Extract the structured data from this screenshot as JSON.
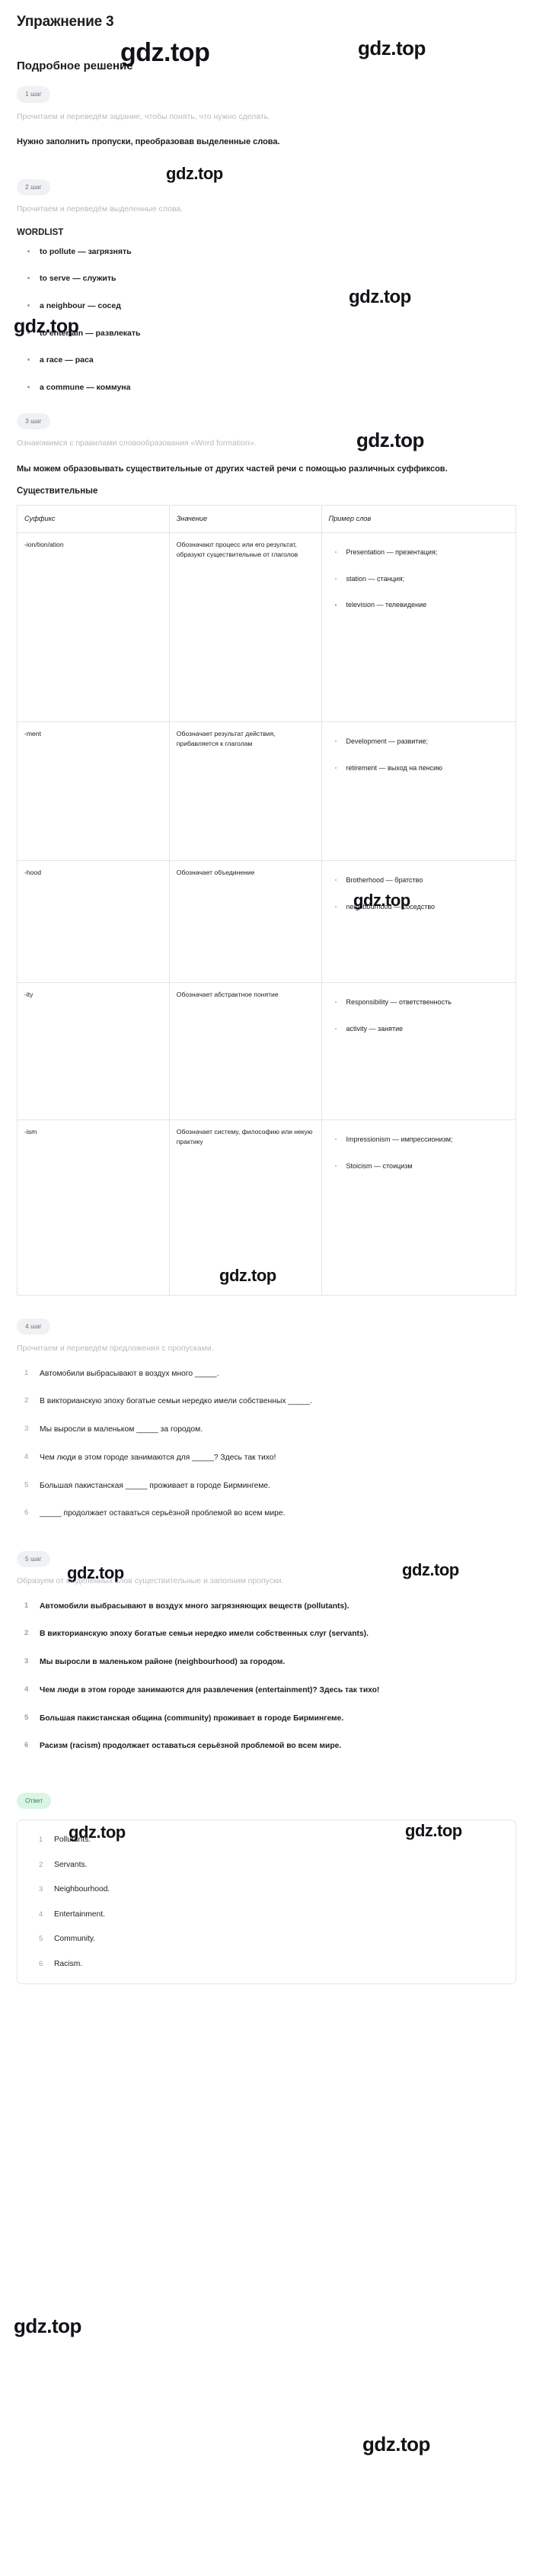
{
  "page": {
    "exercise_title": "Упражнение 3",
    "solution_title": "Подробное решение"
  },
  "watermark": {
    "text": "gdz.top"
  },
  "steps": {
    "step1": {
      "chip": "1 шаг",
      "intro": "Прочитаем и переведём задание, чтобы понять, что нужно сделать.",
      "task": "Нужно заполнить пропуски, преобразовав выделенные слова."
    },
    "step2": {
      "chip": "2 шаг",
      "intro": "Прочитаем и переведём выделенные слова.",
      "wordlist_label": "WORDLIST",
      "words": [
        "to pollute — загрязнять",
        "to serve — служить",
        "a neighbour — сосед",
        "to entertain — развлекать",
        "a race — раса",
        "a commune — коммуна"
      ]
    },
    "step3": {
      "chip": "3 шаг",
      "intro": "Ознакомимся с правилами словообразования «Word formation».",
      "task": "Мы можем образовывать существительные от других частей речи с помощью различных суффиксов.",
      "table_label": "Существительные",
      "table": {
        "headers": [
          "Суффикс",
          "Значение",
          "Пример слов"
        ],
        "rows": [
          {
            "suffix": "-ion/tion/ation",
            "meaning": "Обозначают процесс или его результат, образуют существительные от глаголов",
            "examples": [
              "Presentation — презентация;",
              "station — станция;",
              "television — телевидение"
            ]
          },
          {
            "suffix": "-ment",
            "meaning": "Обозначает результат действия, прибавляется к глаголам",
            "examples": [
              "Development — развитие;",
              "retirement — выход на пенсию"
            ]
          },
          {
            "suffix": "-hood",
            "meaning": "Обозначает объединение",
            "examples": [
              "Brotherhood — братство",
              "neighbourhood — соседство"
            ]
          },
          {
            "suffix": "-ity",
            "meaning": "Обозначает абстрактное понятие",
            "examples": [
              "Responsibility — ответственность",
              "activity — занятие"
            ]
          },
          {
            "suffix": "-ism",
            "meaning": "Обозначает систему, философию или некую практику",
            "examples": [
              "Impressionism — импрессионизм;",
              "Stoicism — стоицизм"
            ]
          }
        ]
      }
    },
    "step4": {
      "chip": "4 шаг",
      "intro": "Прочитаем и переведём предложения с пропусками.",
      "sentences": [
        "Автомобили выбрасывают в воздух много _____.",
        "В викторианскую эпоху богатые семьи нередко имели собственных _____.",
        "Мы выросли в маленьком _____ за городом.",
        "Чем люди в этом городе занимаются для _____? Здесь так тихо!",
        "Большая пакистанская _____ проживает в городе Бирмингеме.",
        "_____ продолжает оставаться серьёзной проблемой во всем мире."
      ]
    },
    "step5": {
      "chip": "5 шаг",
      "intro": "Образуем от выделенных слов существительные и заполним пропуски.",
      "sentences": [
        "Автомобили выбрасывают в воздух много загрязняющих веществ (pollutants).",
        "В викторианскую эпоху богатые семьи нередко имели собственных слуг (servants).",
        "Мы выросли в маленьком районе (neighbourhood) за городом.",
        "Чем люди в этом городе занимаются для развлечения (entertainment)? Здесь так тихо!",
        "Большая пакистанская община (community) проживает в городе Бирмингеме.",
        "Расизм (racism) продолжает оставаться серьёзной проблемой во всем мире."
      ]
    }
  },
  "answer": {
    "chip": "Ответ",
    "items": [
      "Pollutants.",
      "Servants.",
      "Neighbourhood.",
      "Entertainment.",
      "Community.",
      "Racism."
    ]
  }
}
